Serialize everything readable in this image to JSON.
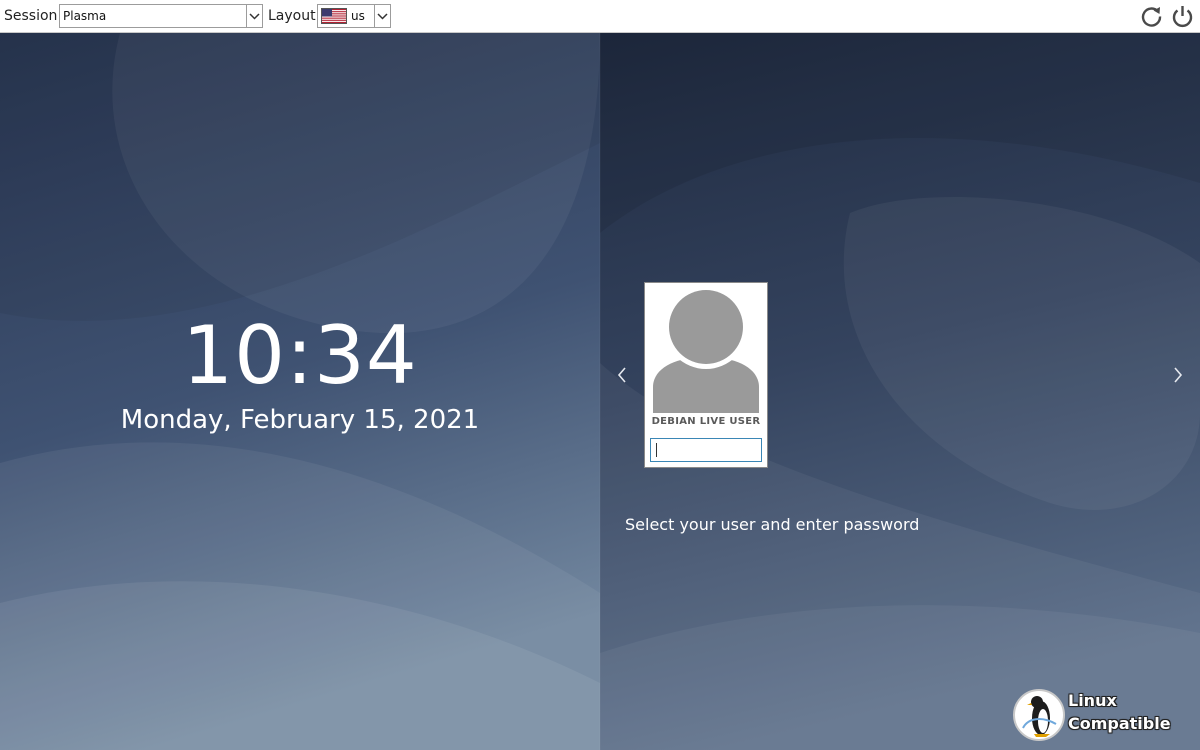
{
  "topbar": {
    "session_label": "Session",
    "session_value": "Plasma",
    "layout_label": "Layout",
    "layout_value": "us",
    "layout_flag_icon": "us-flag-icon",
    "reboot_icon": "reboot-icon",
    "shutdown_icon": "power-icon"
  },
  "clock": {
    "time": "10:34",
    "date": "Monday, February 15, 2021"
  },
  "login": {
    "user_name": "DEBIAN LIVE USER",
    "password_value": "",
    "hint": "Select your user and enter password",
    "prev_icon": "chevron-left-icon",
    "next_icon": "chevron-right-icon",
    "avatar_icon": "user-avatar-icon"
  },
  "watermark": {
    "line1": "Linux",
    "line2": "Compatible"
  },
  "colors": {
    "background_top": "#1f2a40",
    "background_bottom": "#6c82a0",
    "input_focus": "#3a86b5",
    "avatar_gray": "#9a9a9a"
  }
}
